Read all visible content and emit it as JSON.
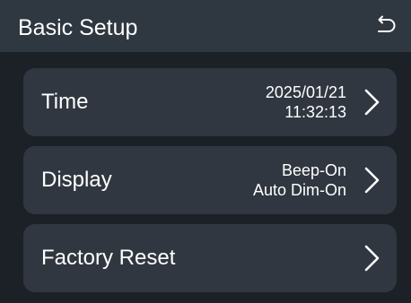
{
  "header": {
    "title": "Basic Setup",
    "back_icon": "return-arrow-icon"
  },
  "items": [
    {
      "label": "Time",
      "values": [
        "2025/01/21",
        "11:32:13"
      ],
      "icon": "chevron-right-icon"
    },
    {
      "label": "Display",
      "values": [
        "Beep-On",
        "Auto Dim-On"
      ],
      "icon": "chevron-right-icon"
    },
    {
      "label": "Factory Reset",
      "values": [],
      "icon": "chevron-right-icon"
    }
  ],
  "colors": {
    "background": "#1c2128",
    "header": "#2f3740",
    "card": "#303740",
    "text": "#ffffff"
  }
}
